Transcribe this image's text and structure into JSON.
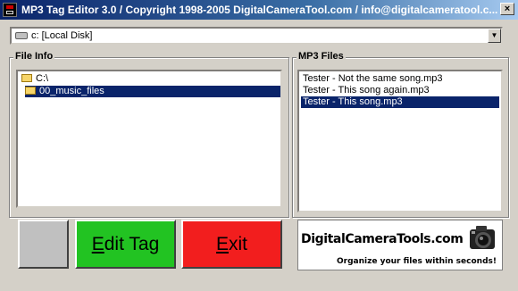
{
  "window": {
    "title": "MP3 Tag Editor 3.0 / Copyright 1998-2005 DigitalCameraTool.com / info@digitalcameratool.c...",
    "close_glyph": "×"
  },
  "drive": {
    "selected": "c: [Local Disk]",
    "dropdown_glyph": "▼"
  },
  "file_info": {
    "caption": "File Info",
    "tree": [
      {
        "label": "C:\\",
        "selected": false
      },
      {
        "label": "00_music_files",
        "selected": true
      }
    ]
  },
  "mp3_files": {
    "caption": "MP3 Files",
    "items": [
      {
        "label": "Tester - Not the same song.mp3",
        "selected": false
      },
      {
        "label": "Tester - This song again.mp3",
        "selected": false
      },
      {
        "label": "Tester - This song.mp3",
        "selected": true
      }
    ]
  },
  "buttons": {
    "edit_tag": {
      "access": "E",
      "rest": "dit Tag"
    },
    "exit": {
      "access": "E",
      "rest": "xit"
    }
  },
  "logo": {
    "brand": "DigitalCameraTools.com",
    "tagline": "Organize your files within seconds!"
  },
  "colors": {
    "edit_tag_bg": "#22c322",
    "exit_bg": "#f21e1e",
    "selection": "#0a246a",
    "title_bar": "#0a246a"
  }
}
